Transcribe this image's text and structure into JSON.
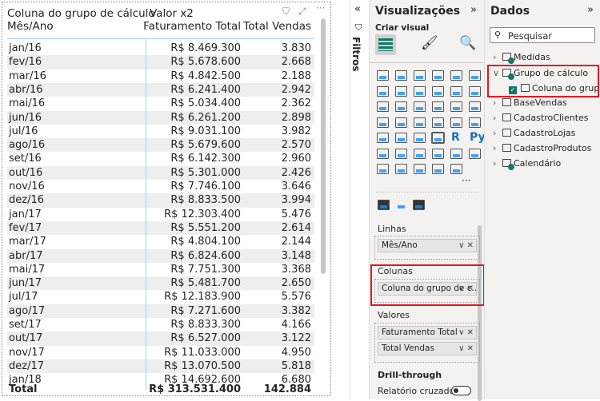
{
  "table": {
    "header_row1": {
      "col1": "Coluna do grupo de cálculo",
      "col2": "Valor x2"
    },
    "header_row2": {
      "col1": "Mês/Ano",
      "col2": "Faturamento Total",
      "col3": "Total Vendas"
    },
    "rows": [
      [
        "jan/16",
        "R$ 8.469.300",
        "3.830"
      ],
      [
        "fev/16",
        "R$ 5.678.600",
        "2.668"
      ],
      [
        "mar/16",
        "R$ 4.842.500",
        "2.188"
      ],
      [
        "abr/16",
        "R$ 6.241.400",
        "2.942"
      ],
      [
        "mai/16",
        "R$ 5.034.400",
        "2.362"
      ],
      [
        "jun/16",
        "R$ 6.261.200",
        "2.898"
      ],
      [
        "jul/16",
        "R$ 9.031.100",
        "3.982"
      ],
      [
        "ago/16",
        "R$ 5.679.600",
        "2.570"
      ],
      [
        "set/16",
        "R$ 6.142.300",
        "2.960"
      ],
      [
        "out/16",
        "R$ 5.301.000",
        "2.426"
      ],
      [
        "nov/16",
        "R$ 7.746.100",
        "3.646"
      ],
      [
        "dez/16",
        "R$ 8.833.500",
        "3.994"
      ],
      [
        "jan/17",
        "R$ 12.303.400",
        "5.476"
      ],
      [
        "fev/17",
        "R$ 5.551.200",
        "2.614"
      ],
      [
        "mar/17",
        "R$ 4.804.100",
        "2.144"
      ],
      [
        "abr/17",
        "R$ 6.824.600",
        "3.148"
      ],
      [
        "mai/17",
        "R$ 7.751.300",
        "3.368"
      ],
      [
        "jun/17",
        "R$ 5.481.700",
        "2.650"
      ],
      [
        "jul/17",
        "R$ 12.183.900",
        "5.576"
      ],
      [
        "ago/17",
        "R$ 7.271.600",
        "3.382"
      ],
      [
        "set/17",
        "R$ 8.833.300",
        "4.166"
      ],
      [
        "out/17",
        "R$ 6.527.000",
        "3.122"
      ],
      [
        "nov/17",
        "R$ 11.033.000",
        "4.950"
      ],
      [
        "dez/17",
        "R$ 13.070.500",
        "5.818"
      ],
      [
        "jan/18",
        "R$ 14.692.600",
        "6.680"
      ]
    ],
    "total": [
      "Total",
      "R$ 313.531.400",
      "142.884"
    ]
  },
  "filters": {
    "label": "Filtros"
  },
  "visualizations": {
    "title": "Visualizações",
    "create_label": "Criar visual",
    "wells": {
      "rows_label": "Linhas",
      "rows_field": "Mês/Ano",
      "columns_label": "Colunas",
      "columns_field": "Coluna do grupo de c...",
      "values_label": "Valores",
      "values_fields": [
        "Faturamento Total",
        "Total Vendas"
      ],
      "drill_label": "Drill-through",
      "cross_report_label": "Relatório cruzado",
      "cross_report_on": false
    },
    "more": "···",
    "r_label": "R",
    "py_label": "Py"
  },
  "data_pane": {
    "title": "Dados",
    "search_placeholder": "Pesquisar",
    "items": [
      {
        "label": "Medidas",
        "expanded": false
      },
      {
        "label": "Grupo de cálculo",
        "expanded": true
      },
      {
        "label": "BaseVendas",
        "expanded": false
      },
      {
        "label": "CadastroClientes",
        "expanded": false
      },
      {
        "label": "CadastroLojas",
        "expanded": false
      },
      {
        "label": "CadastroProdutos",
        "expanded": false
      },
      {
        "label": "Calendário",
        "expanded": false
      }
    ],
    "child_item": {
      "label": "Coluna do grupo...",
      "checked": true
    }
  },
  "colors": {
    "highlight": "#e81123",
    "accent": "#117865",
    "selection_line": "#a6d0f0"
  }
}
